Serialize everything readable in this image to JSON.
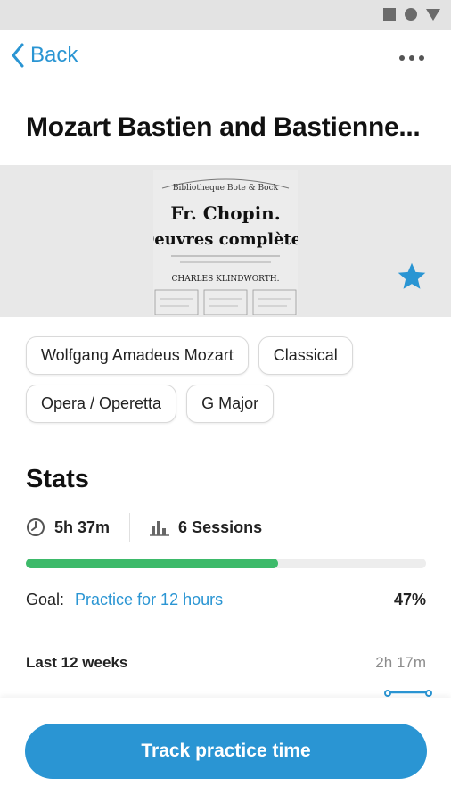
{
  "nav": {
    "back_label": "Back"
  },
  "title": "Mozart Bastien and Bastienne...",
  "cover": {
    "lines": [
      "Bibliotheque Bote & Bock",
      "Fr. Chopin.",
      "Oeuvres complètes",
      "CHARLES KLINDWORTH."
    ]
  },
  "tags": [
    [
      "Wolfgang Amadeus Mozart",
      "Classical"
    ],
    [
      "Opera / Operetta",
      "G Major"
    ]
  ],
  "stats": {
    "heading": "Stats",
    "time": "5h 37m",
    "sessions": "6 Sessions",
    "progress_fraction": 0.63
  },
  "goal": {
    "label": "Goal:",
    "text": "Practice for 12 hours",
    "percent": "47%"
  },
  "weeks": {
    "label": "Last 12 weeks",
    "value": "2h 17m"
  },
  "cta": {
    "label": "Track practice time"
  },
  "colors": {
    "accent": "#2a95d3",
    "progress": "#3dba6a"
  }
}
